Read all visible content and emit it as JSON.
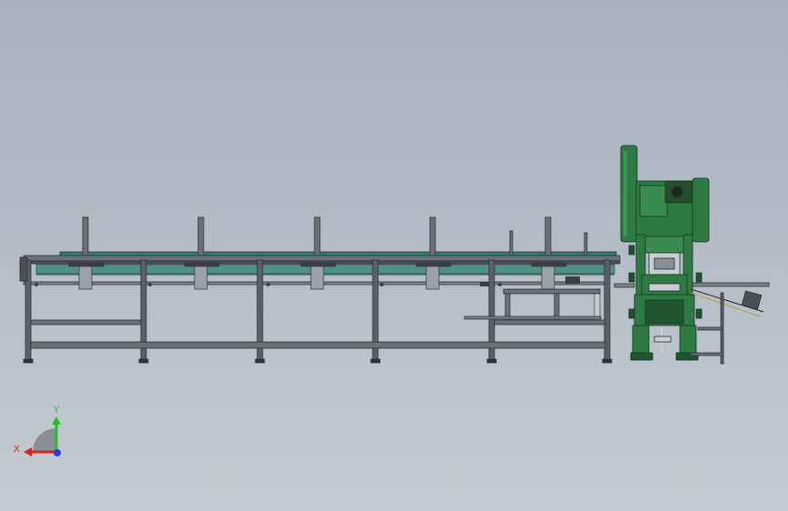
{
  "triad": {
    "x_label": "X",
    "y_label": "Y",
    "x_color": "#e0201c",
    "y_color": "#22c02a",
    "z_color": "#2a3ae0"
  },
  "colors": {
    "background_top": "#a7b1bd",
    "background_bottom": "#c4cbd2",
    "frame_steel": "#5b6068",
    "frame_dark": "#2e3238",
    "belt_teal": "#2f7c74",
    "machine_green": "#2f7a44",
    "machine_dark_green": "#1f5530",
    "cylinder_grey": "#9aa1a8"
  },
  "scene": {
    "icon": "cad-assembly-side-view",
    "components": [
      "long-conveyor-frame",
      "punch-press-machine",
      "discharge-chute"
    ]
  }
}
